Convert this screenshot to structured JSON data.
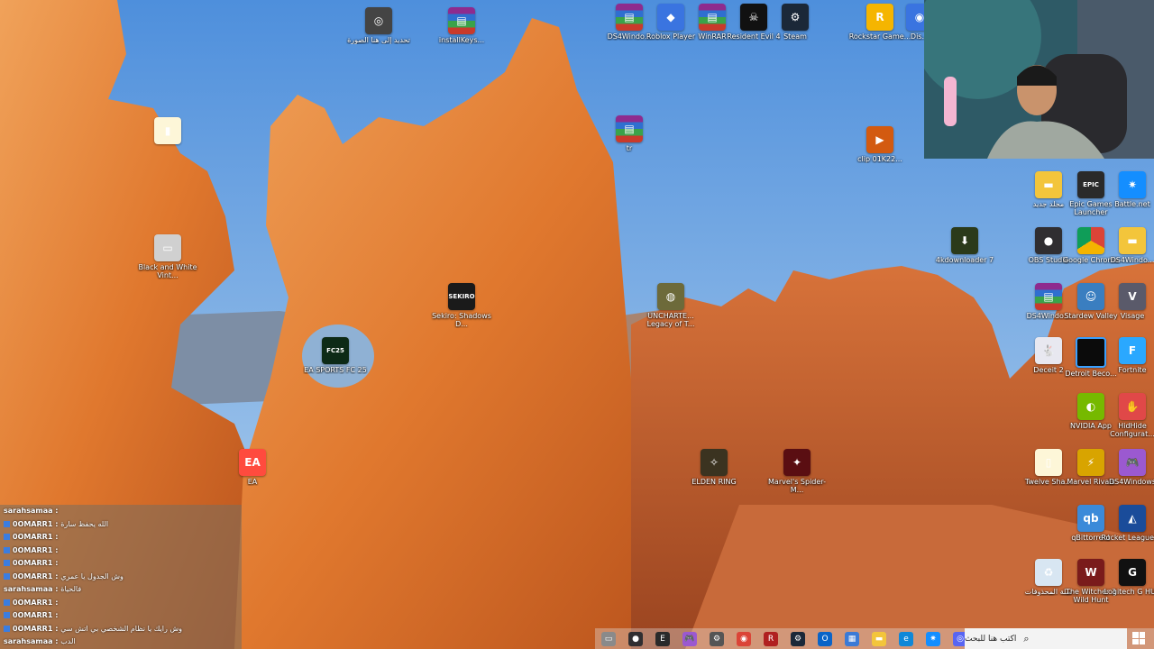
{
  "desktop_icons": [
    {
      "label": "تحديد إلى هنا الصورة",
      "glyph": "◎",
      "cls": "g-gear"
    },
    {
      "label": "installKeys...",
      "glyph": "▤",
      "cls": "g-winrar"
    },
    {
      "label": "DS4Windo...",
      "glyph": "▤",
      "cls": "g-winrar"
    },
    {
      "label": "Roblox Player",
      "glyph": "◆",
      "cls": "g-roblox"
    },
    {
      "label": "WinRAR",
      "glyph": "▤",
      "cls": "g-winrar"
    },
    {
      "label": "Resident Evil 4",
      "glyph": "☠",
      "cls": "g-black"
    },
    {
      "label": "Steam",
      "glyph": "⚙",
      "cls": "g-steam"
    },
    {
      "label": "Rockstar Game...",
      "glyph": "R",
      "cls": "g-rockstar"
    },
    {
      "label": "Dis...",
      "glyph": "◉",
      "cls": "g-roblox"
    },
    {
      "label": "",
      "glyph": "▮",
      "cls": "g-text"
    },
    {
      "label": "tr",
      "glyph": "▤",
      "cls": "g-winrar"
    },
    {
      "label": "clip 01K22...",
      "glyph": "▶",
      "cls": "g-clip"
    },
    {
      "label": "مجلد جديد",
      "glyph": "▬",
      "cls": "g-folder"
    },
    {
      "label": "Epic Games Launcher",
      "glyph": "EPIC",
      "cls": "g-epic"
    },
    {
      "label": "Battle.net",
      "glyph": "✷",
      "cls": "g-bnet"
    },
    {
      "label": "Black and White Vint...",
      "glyph": "▭",
      "cls": "g-blank"
    },
    {
      "label": "4kdownloader 7",
      "glyph": "⬇",
      "cls": "g-4k"
    },
    {
      "label": "OBS Studio",
      "glyph": "●",
      "cls": "g-obs"
    },
    {
      "label": "Google Chrome",
      "glyph": "",
      "cls": "g-chrome"
    },
    {
      "label": "DS4Windo...",
      "glyph": "▬",
      "cls": "g-folder"
    },
    {
      "label": "Sekiro: Shadows D...",
      "glyph": "SEKIRO",
      "cls": "g-sekiro"
    },
    {
      "label": "UNCHARTE... Legacy of T...",
      "glyph": "◍",
      "cls": "g-uncharted"
    },
    {
      "label": "DS4Windo...",
      "glyph": "▤",
      "cls": "g-winrar"
    },
    {
      "label": "Stardew Valley",
      "glyph": "☺",
      "cls": "g-stardew"
    },
    {
      "label": "Visage",
      "glyph": "V",
      "cls": "g-visage"
    },
    {
      "label": "EA SPORTS FC 25",
      "glyph": "FC25",
      "cls": "g-fc"
    },
    {
      "label": "Deceit 2",
      "glyph": "🐇",
      "cls": "g-deceit"
    },
    {
      "label": "Detroit Beco...",
      "glyph": "",
      "cls": "g-detroit"
    },
    {
      "label": "Fortnite",
      "glyph": "F",
      "cls": "g-fortnite"
    },
    {
      "label": "NVIDIA App",
      "glyph": "◐",
      "cls": "g-nvidia"
    },
    {
      "label": "HidHide Configurat...",
      "glyph": "✋",
      "cls": "g-hid"
    },
    {
      "label": "EA",
      "glyph": "EA",
      "cls": "g-ea"
    },
    {
      "label": "ELDEN RING",
      "glyph": "✧",
      "cls": "g-elden"
    },
    {
      "label": "Marvel's Spider-M...",
      "glyph": "✦",
      "cls": "g-spider"
    },
    {
      "label": "Twelve Sha...",
      "glyph": "▯",
      "cls": "g-text"
    },
    {
      "label": "Marvel Rivals",
      "glyph": "⚡",
      "cls": "g-rivals"
    },
    {
      "label": "DS4Windows",
      "glyph": "🎮",
      "cls": "g-ds4"
    },
    {
      "label": "qBittorrent",
      "glyph": "qb",
      "cls": "g-qbit"
    },
    {
      "label": "Rocket League ®",
      "glyph": "◭",
      "cls": "g-rl"
    },
    {
      "label": "سلة المحذوفات",
      "glyph": "♻",
      "cls": "g-recycle"
    },
    {
      "label": "The Witcher 3 Wild Hunt",
      "glyph": "W",
      "cls": "g-witcher"
    },
    {
      "label": "Logitech G HUB",
      "glyph": "G",
      "cls": "g-logi"
    }
  ],
  "chat": [
    {
      "user": "sarahsamaa :",
      "msg": "",
      "badge": false
    },
    {
      "user": "0OMARR1 :",
      "msg": "الله يحفظ سارة",
      "badge": true
    },
    {
      "user": "0OMARR1 :",
      "msg": "",
      "badge": true
    },
    {
      "user": "0OMARR1 :",
      "msg": "",
      "badge": true
    },
    {
      "user": "0OMARR1 :",
      "msg": "",
      "badge": true
    },
    {
      "user": "0OMARR1 :",
      "msg": "وش الجدول يا عمري",
      "badge": true
    },
    {
      "user": "sarahsamaa :",
      "msg": "فالحياة",
      "badge": false
    },
    {
      "user": "0OMARR1 :",
      "msg": "",
      "badge": true
    },
    {
      "user": "0OMARR1 :",
      "msg": "",
      "badge": true
    },
    {
      "user": "0OMARR1 :",
      "msg": "وش رايك يا نظام الشخصي بي اتش سي",
      "badge": true
    },
    {
      "user": "sarahsamaa :",
      "msg": "الدب",
      "badge": false
    }
  ],
  "search": {
    "placeholder": "اكتب هنا للبحث"
  },
  "taskbar_icons": [
    {
      "name": "task-view-icon",
      "glyph": "▭",
      "color": "#8a8a8a"
    },
    {
      "name": "obs-taskbar-icon",
      "glyph": "●",
      "color": "#302e31"
    },
    {
      "name": "epic-taskbar-icon",
      "glyph": "E",
      "color": "#2a2a2a"
    },
    {
      "name": "ds4-taskbar-icon",
      "glyph": "🎮",
      "color": "#9b59d0"
    },
    {
      "name": "settings-taskbar-icon",
      "glyph": "⚙",
      "color": "#555555"
    },
    {
      "name": "chrome-taskbar-icon",
      "glyph": "◉",
      "color": "#db4437"
    },
    {
      "name": "rockstar-taskbar-icon",
      "glyph": "R",
      "color": "#b02020"
    },
    {
      "name": "steam-taskbar-icon",
      "glyph": "⚙",
      "color": "#1b2838"
    },
    {
      "name": "outlook-taskbar-icon",
      "glyph": "O",
      "color": "#0a64c8"
    },
    {
      "name": "store-taskbar-icon",
      "glyph": "▦",
      "color": "#3a7ad6"
    },
    {
      "name": "explorer-taskbar-icon",
      "glyph": "▬",
      "color": "#f3c53b"
    },
    {
      "name": "edge-taskbar-icon",
      "glyph": "e",
      "color": "#0f88d8"
    },
    {
      "name": "bnet-taskbar-icon",
      "glyph": "✷",
      "color": "#148eff"
    },
    {
      "name": "discord-taskbar-icon",
      "glyph": "◎",
      "color": "#5865f2"
    }
  ]
}
